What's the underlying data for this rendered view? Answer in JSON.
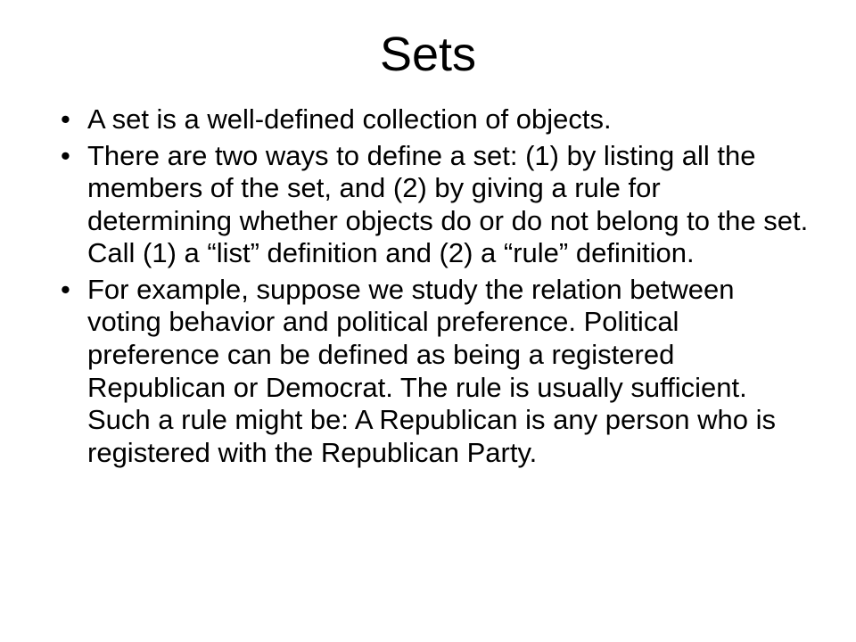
{
  "slide": {
    "title": "Sets",
    "bullets": [
      "A set is a well-defined collection of objects.",
      "There are two ways to define a set: (1) by listing all the members of the set, and (2) by giving a rule for determining whether objects do or do not belong to the set. Call (1) a “list” definition and (2) a “rule” definition.",
      "For example, suppose we study the relation between voting behavior and political preference. Political preference can be defined as being a registered Republican or Democrat. The rule is usually sufficient. Such a rule might be: A Republican is any person who is registered with the Republican Party."
    ]
  }
}
